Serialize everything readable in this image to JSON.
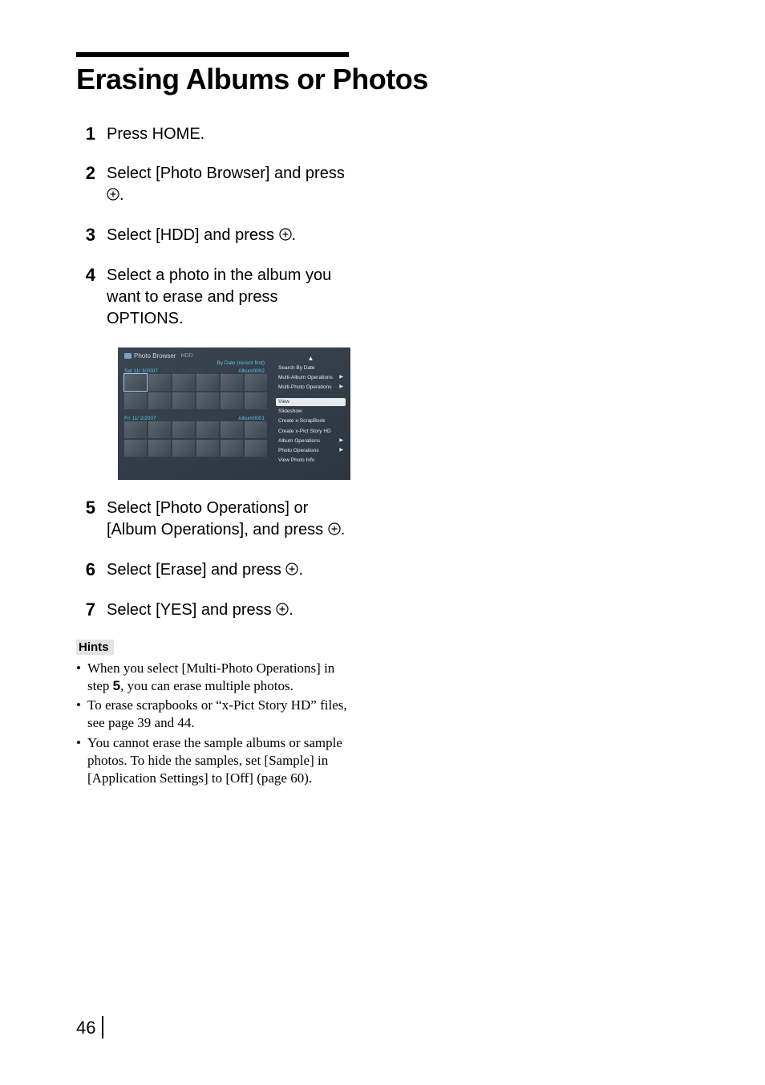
{
  "title": "Erasing Albums or Photos",
  "steps": [
    {
      "num": "1",
      "text": "Press HOME."
    },
    {
      "num": "2",
      "text_parts": [
        "Select [Photo Browser] and press ",
        "."
      ]
    },
    {
      "num": "3",
      "text_parts": [
        "Select [HDD] and press ",
        "."
      ]
    },
    {
      "num": "4",
      "text": "Select a photo in the album you want to erase and press OPTIONS."
    },
    {
      "num": "5",
      "text_parts": [
        "Select [Photo Operations] or [Album Operations], and press ",
        "."
      ]
    },
    {
      "num": "6",
      "text_parts": [
        "Select [Erase] and press ",
        "."
      ]
    },
    {
      "num": "7",
      "text_parts": [
        "Select [YES] and press ",
        "."
      ]
    }
  ],
  "screenshot": {
    "title": "Photo Browser",
    "badge": "HDD",
    "sort": "By Date (recent first)",
    "albums": [
      {
        "date": "Sat 11/ 3/2007",
        "name": "Album0002"
      },
      {
        "date": "Fri 11/ 2/2007",
        "name": "Album0001"
      }
    ],
    "options_top": [
      {
        "label": "Search By Date",
        "arrow": false
      },
      {
        "label": "Multi-Album Operations",
        "arrow": true
      },
      {
        "label": "Multi-Photo Operations",
        "arrow": true
      }
    ],
    "option_highlight": "View",
    "options_bottom": [
      {
        "label": "Slideshow",
        "arrow": false
      },
      {
        "label": "Create x-ScrapBook",
        "arrow": false
      },
      {
        "label": "Create x-Pict Story HD",
        "arrow": false
      },
      {
        "label": "Album Operations",
        "arrow": true
      },
      {
        "label": "Photo Operations",
        "arrow": true
      },
      {
        "label": "View Photo Info",
        "arrow": false
      }
    ]
  },
  "hints_label": "Hints",
  "hints": [
    {
      "pre": "When you select [Multi-Photo Operations] in step ",
      "bold": "5",
      "post": ", you can erase multiple photos."
    },
    {
      "text": "To erase scrapbooks or “x-Pict Story HD” files, see page 39 and 44."
    },
    {
      "text": "You cannot erase the sample albums or sample photos. To hide the samples, set [Sample] in [Application Settings] to [Off] (page 60)."
    }
  ],
  "page_number": "46"
}
